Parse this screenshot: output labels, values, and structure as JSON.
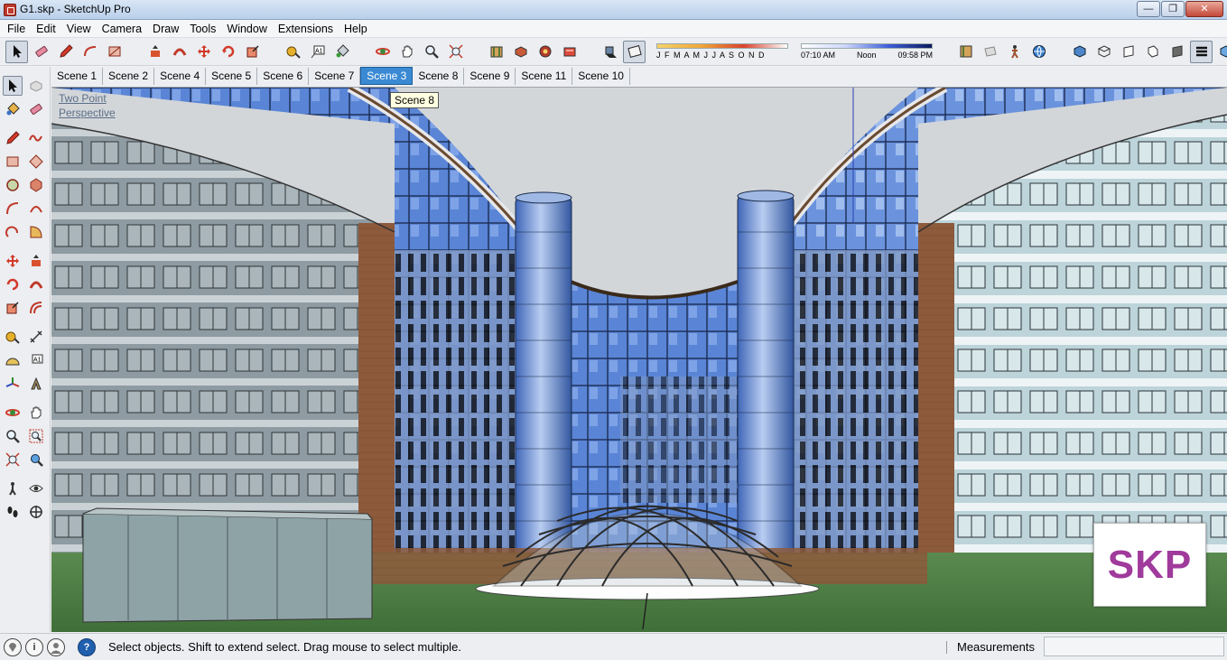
{
  "window": {
    "title": "G1.skp - SketchUp Pro",
    "minimize_label": "—",
    "maximize_label": "❐",
    "close_label": "✕"
  },
  "menu": [
    "File",
    "Edit",
    "View",
    "Camera",
    "Draw",
    "Tools",
    "Window",
    "Extensions",
    "Help"
  ],
  "shadow": {
    "months_label": "J F M A M J J A S O N D",
    "time_start": "07:10 AM",
    "time_mid": "Noon",
    "time_end": "09:58 PM"
  },
  "scenes": {
    "tabs": [
      "Scene 1",
      "Scene 2",
      "Scene 4",
      "Scene 5",
      "Scene 6",
      "Scene 7",
      "Scene 3",
      "Scene 8",
      "Scene 9",
      "Scene 11",
      "Scene 10"
    ],
    "active": "Scene 3",
    "tooltip": "Scene 8"
  },
  "viewport": {
    "camera_line1": "Two Point",
    "camera_line2": "Perspective",
    "watermark": "SKP"
  },
  "status": {
    "hint": "Select objects. Shift to extend select. Drag mouse to select multiple.",
    "measurements_label": "Measurements",
    "measurements_value": "",
    "info_icon_label": "i",
    "help_icon_label": "?"
  },
  "colors": {
    "sky": "#d3d6d9",
    "glass": "#5f86d8",
    "ground": "#4f7e45",
    "brick": "#8d5a3c",
    "accent": "#3a8ad3"
  }
}
